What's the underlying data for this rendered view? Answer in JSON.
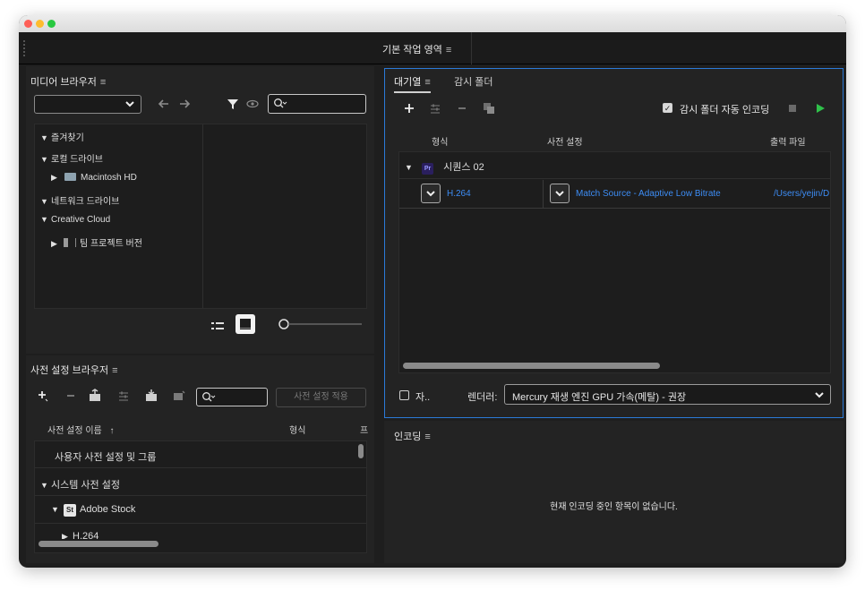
{
  "workspace": {
    "title": "기본 작업 영역"
  },
  "media_browser": {
    "title": "미디어 브라우저",
    "tree": [
      {
        "label": "즐겨찾기"
      },
      {
        "label": "로컬 드라이브"
      },
      {
        "label": "Macintosh HD"
      },
      {
        "label": "네트워크 드라이브"
      },
      {
        "label": "Creative Cloud"
      },
      {
        "label": "팀 프로젝트 버전"
      }
    ]
  },
  "preset_browser": {
    "title": "사전 설정 브라우저",
    "apply_label": "사전 설정 적용",
    "col_name": "사전 설정 이름",
    "col_format": "형식",
    "col_extra": "프",
    "items": [
      {
        "label": "사용자 사전 설정 및 그룹"
      },
      {
        "label": "시스템 사전 설정"
      },
      {
        "label": "Adobe Stock",
        "badge": "St"
      },
      {
        "label": "H.264"
      }
    ]
  },
  "queue": {
    "tab_queue": "대기열",
    "tab_watch": "감시 폴더",
    "auto_encode_label": "감시 폴더 자동 인코딩",
    "col_format": "형식",
    "col_preset": "사전 설정",
    "col_output": "출력 파일",
    "sequence": {
      "badge": "Pr",
      "name": "시퀀스 02"
    },
    "item": {
      "format": "H.264",
      "preset": "Match Source - Adaptive Low Bitrate",
      "output": "/Users/yejin/D"
    },
    "bottom_checkbox_label": "자..",
    "renderer_label": "렌더러:",
    "renderer_value": "Mercury 재생 엔진 GPU 가속(메탈) - 권장",
    "accent_color": "#3d8df5",
    "start_color": "#2fc14a"
  },
  "encoding": {
    "title": "인코딩",
    "empty_message": "현재 인코딩 중인 항목이 없습니다."
  }
}
